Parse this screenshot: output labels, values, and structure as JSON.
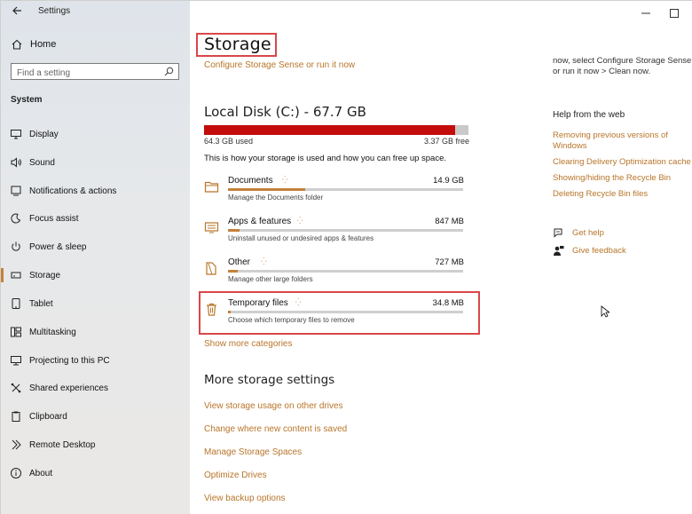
{
  "window": {
    "app_title": "Settings"
  },
  "sidebar": {
    "home_label": "Home",
    "search_placeholder": "Find a setting",
    "section_title": "System",
    "items": [
      {
        "label": "Display",
        "icon": "display-icon"
      },
      {
        "label": "Sound",
        "icon": "sound-icon"
      },
      {
        "label": "Notifications & actions",
        "icon": "notifications-icon"
      },
      {
        "label": "Focus assist",
        "icon": "focus-assist-icon"
      },
      {
        "label": "Power & sleep",
        "icon": "power-icon"
      },
      {
        "label": "Storage",
        "icon": "storage-icon",
        "active": true
      },
      {
        "label": "Tablet",
        "icon": "tablet-icon"
      },
      {
        "label": "Multitasking",
        "icon": "multitasking-icon"
      },
      {
        "label": "Projecting to this PC",
        "icon": "projecting-icon"
      },
      {
        "label": "Shared experiences",
        "icon": "shared-experiences-icon"
      },
      {
        "label": "Clipboard",
        "icon": "clipboard-icon"
      },
      {
        "label": "Remote Desktop",
        "icon": "remote-desktop-icon"
      },
      {
        "label": "About",
        "icon": "about-icon"
      }
    ]
  },
  "main": {
    "page_title": "Storage",
    "configure_link": "Configure Storage Sense or run it now",
    "disk": {
      "title": "Local Disk (C:) - 67.7 GB",
      "used": "64.3 GB used",
      "free": "3.37 GB free",
      "used_fraction": 0.95
    },
    "usage_text": "This is how your storage is used and how you can free up space.",
    "categories": [
      {
        "name": "Documents",
        "size": "14.9 GB",
        "description": "Manage the Documents folder",
        "fill_fraction": 0.33,
        "icon": "documents-folder-icon"
      },
      {
        "name": "Apps & features",
        "size": "847 MB",
        "description": "Uninstall unused or undesired apps & features",
        "fill_fraction": 0.05,
        "icon": "apps-features-icon"
      },
      {
        "name": "Other",
        "size": "727 MB",
        "description": "Manage other large folders",
        "fill_fraction": 0.04,
        "icon": "other-folders-icon"
      },
      {
        "name": "Temporary files",
        "size": "34.8 MB",
        "description": "Choose which temporary files to remove",
        "fill_fraction": 0.01,
        "icon": "trash-icon"
      }
    ],
    "show_more": "Show more categories",
    "more_settings_title": "More storage settings",
    "more_links": [
      "View storage usage on other drives",
      "Change where new content is saved",
      "Manage Storage Spaces",
      "Optimize Drives",
      "View backup options"
    ]
  },
  "right": {
    "tip_line1": "now, select Configure Storage Sense",
    "tip_line2": "or run it now > Clean now.",
    "help_title": "Help from the web",
    "help_links": [
      "Removing previous versions of Windows",
      "Clearing Delivery Optimization cache",
      "Showing/hiding the Recycle Bin",
      "Deleting Recycle Bin files"
    ],
    "get_help": "Get help",
    "give_feedback": "Give feedback"
  },
  "colors": {
    "accent": "#c4813a",
    "link": "#b8752a",
    "disk_used": "#c40c0c",
    "highlight": "#d9474a"
  }
}
